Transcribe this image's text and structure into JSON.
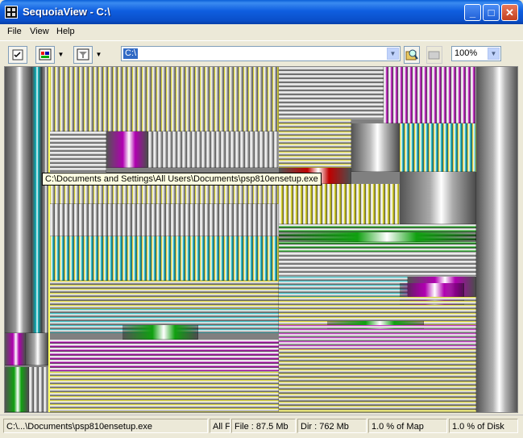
{
  "window": {
    "title": "SequoiaView - C:\\",
    "minimize": "_",
    "maximize": "□",
    "close": "✕"
  },
  "menu": [
    "File",
    "View",
    "Help"
  ],
  "toolbar": {
    "path_value": "C:\\",
    "zoom_value": "100%"
  },
  "tooltip": "C:\\Documents and Settings\\All Users\\Documents\\psp810ensetup.exe",
  "status": {
    "path": "C:\\...\\Documents\\psp810ensetup.exe",
    "filter": "All Fi",
    "file_size": "File : 87.5 Mb",
    "dir_size": "Dir : 762 Mb",
    "map_pct": "1.0 % of Map",
    "disk_pct": "1.0 % of Disk"
  },
  "colors": {
    "yellow": "#c8c000",
    "gray": "#b8b8b8",
    "cyan": "#00a8b0",
    "magenta": "#b000b0",
    "green": "#10a010",
    "red": "#c00000"
  }
}
